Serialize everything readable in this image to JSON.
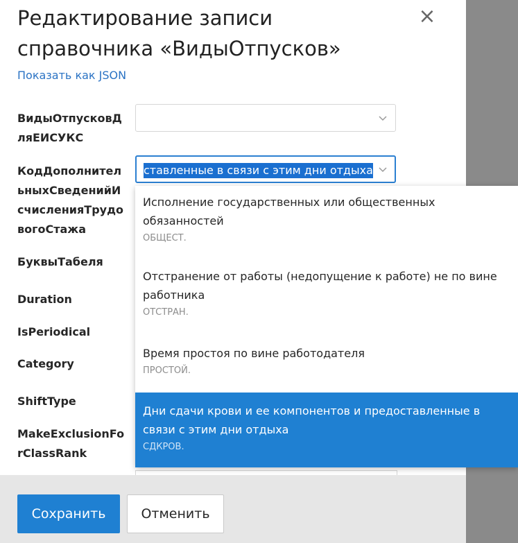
{
  "dialog": {
    "title": "Редактирование записи справочника «ВидыОтпусков»",
    "close_glyph": "×",
    "json_link": "Показать как JSON"
  },
  "fields": [
    {
      "label": "ВидыОтпусковДляЕИСУКС"
    },
    {
      "label": "КодДополнительныхСведенийИсчисленияТрудовогоСтажа",
      "selected_text": "ставленные в связи с этим дни отдыха"
    },
    {
      "label": "БуквыТабеля"
    },
    {
      "label": "Duration"
    },
    {
      "label": "IsPeriodical"
    },
    {
      "label": "Category"
    },
    {
      "label": "ShiftType"
    },
    {
      "label": "MakeExclusionForClassRank"
    }
  ],
  "dropdown": {
    "options": [
      {
        "name": "Исполнение государственных или общественных обязанностей",
        "code": "ОБЩЕСТ."
      },
      {
        "name": "Отстранение от работы (недопущение к работе) не по вине работника",
        "code": "ОТСТРАН."
      },
      {
        "name": "Время простоя по вине работодателя",
        "code": "ПРОСТОЙ."
      },
      {
        "name": "Дни сдачи крови и ее компонентов и предоставленные в связи с этим дни отдыха",
        "code": "СДКРОВ.",
        "selected": true
      }
    ]
  },
  "footer": {
    "save_label": "Сохранить",
    "cancel_label": "Отменить"
  },
  "colors": {
    "accent": "#1f80d2",
    "link": "#2b73c4",
    "overlay": "#8a8a8a"
  }
}
